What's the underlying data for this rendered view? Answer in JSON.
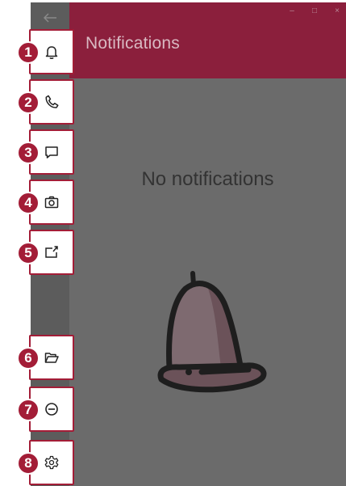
{
  "window": {
    "title": "Notifications",
    "controls": [
      "–",
      "□",
      "×"
    ]
  },
  "main": {
    "empty_message": "No notifications"
  },
  "callouts": [
    {
      "number": "1",
      "icon": "bell-icon"
    },
    {
      "number": "2",
      "icon": "phone-icon"
    },
    {
      "number": "3",
      "icon": "chat-icon"
    },
    {
      "number": "4",
      "icon": "camera-icon"
    },
    {
      "number": "5",
      "icon": "share-screen-icon"
    },
    {
      "number": "6",
      "icon": "folder-open-icon"
    },
    {
      "number": "7",
      "icon": "do-not-disturb-icon"
    },
    {
      "number": "8",
      "icon": "settings-gear-icon"
    }
  ],
  "colors": {
    "accent": "#a31d37",
    "header": "#8b1f3c",
    "body_overlay": "#6b6b6b",
    "sidebar": "#5c5c5c"
  }
}
